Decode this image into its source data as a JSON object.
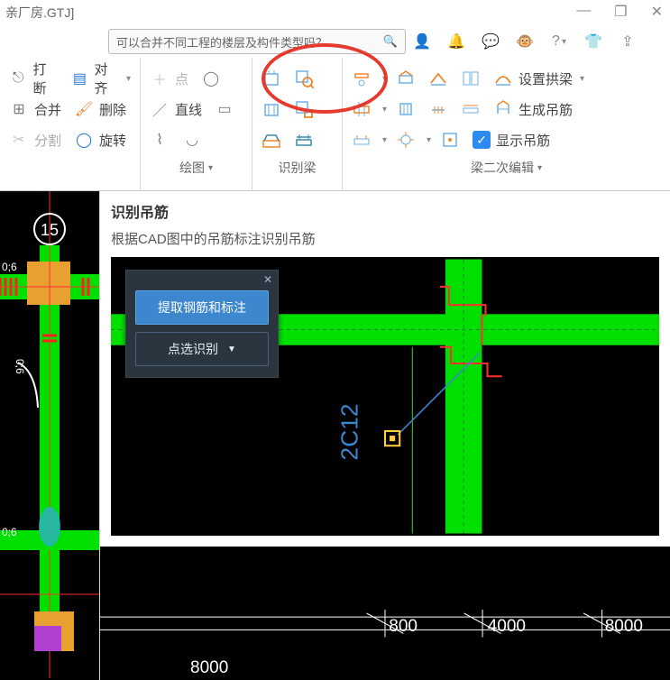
{
  "title_suffix": "亲厂房.GTJ]",
  "search_placeholder": "可以合并不同工程的楼层及构件类型吗？",
  "ribbon": {
    "g1": {
      "break_label": "打断",
      "align_label": "对齐",
      "merge_label": "合并",
      "delete_label": "删除",
      "split_label": "分割",
      "rotate_label": "旋转"
    },
    "g2": {
      "point_label": "点",
      "line_label": "直线",
      "group_label": "绘图"
    },
    "g3": {
      "group_label": "识别梁"
    },
    "g4": {
      "set_arch_label": "设置拱梁",
      "gen_stir_label": "生成吊筋",
      "show_stir_label": "显示吊筋",
      "group_label": "梁二次编辑"
    }
  },
  "tooltip": {
    "title": "识别吊筋",
    "desc": "根据CAD图中的吊筋标注识别吊筋",
    "btn1": "提取钢筋和标注",
    "btn2": "点选识别",
    "cad_text": "2C12"
  },
  "left_tags": {
    "circle": "15",
    "d1": "0;6",
    "d2": "0;6",
    "d3": "0;6"
  },
  "bottom_axis": {
    "a": "800",
    "b": "4000",
    "c": "8000",
    "d": "8000"
  }
}
